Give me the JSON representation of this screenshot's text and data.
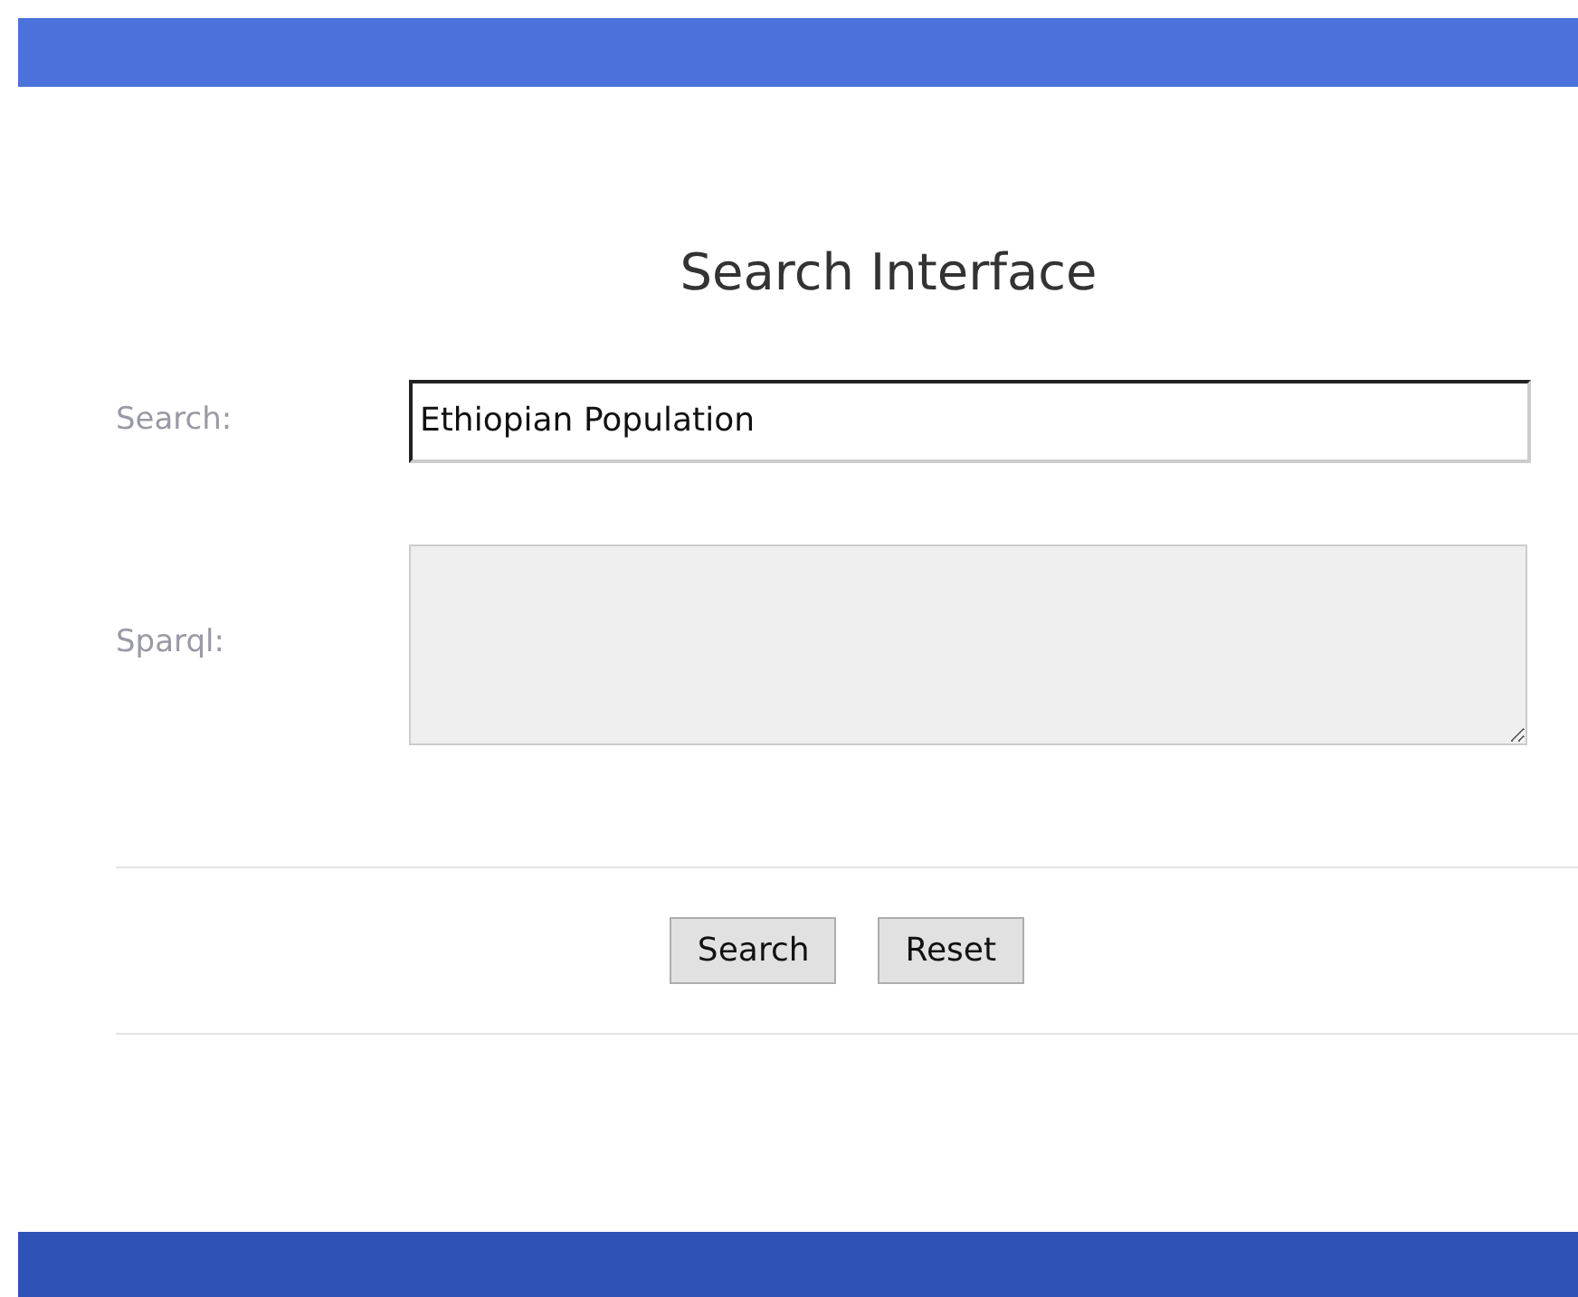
{
  "title": "Search Interface",
  "fields": [
    {
      "kind": "input",
      "label": "Search:",
      "value": "Ethiopian Population",
      "disabled": false
    },
    {
      "kind": "textarea",
      "label": "Sparql:",
      "disabled": true
    }
  ],
  "buttons": [
    "Search",
    "Reset"
  ]
}
